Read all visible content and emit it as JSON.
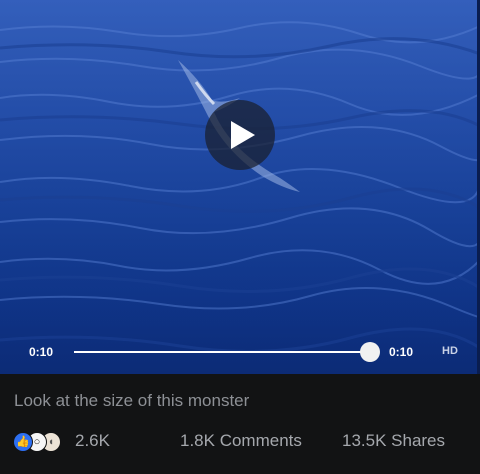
{
  "player": {
    "current_time": "0:10",
    "total_time": "0:10",
    "quality_label": "HD",
    "progress_fraction": 1.0,
    "play_icon": "play-icon"
  },
  "post": {
    "caption": "Look at the size of this monster"
  },
  "stats": {
    "reaction_icons": [
      "like-icon",
      "wow-icon",
      "sad-icon"
    ],
    "reaction_count": "2.6K",
    "comments": "1.8K Comments",
    "shares": "13.5K Shares"
  },
  "colors": {
    "water_top": "#2c57b4",
    "water_bottom": "#0c2b76",
    "background": "#121314",
    "like_blue": "#2d6ff1"
  }
}
